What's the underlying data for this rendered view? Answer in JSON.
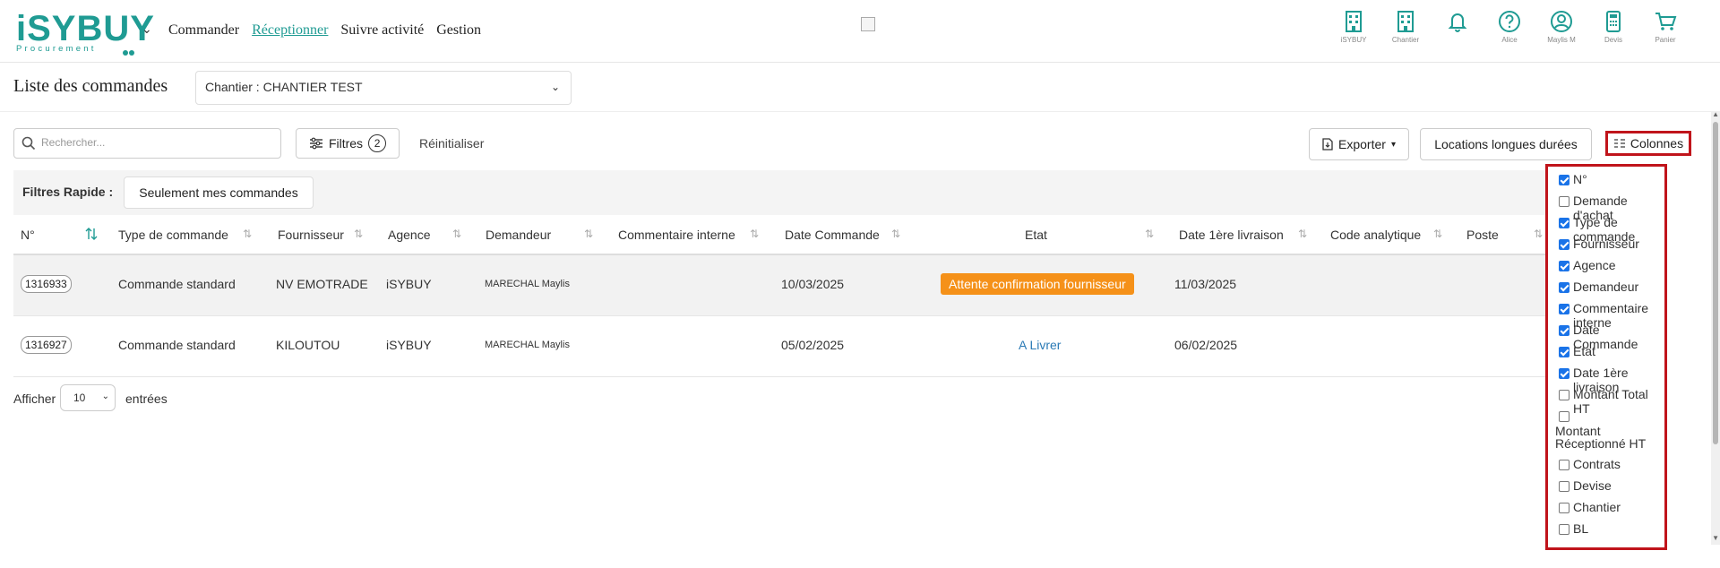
{
  "brand": {
    "name": "iSYBUY",
    "sub": "Procurement"
  },
  "nav": [
    "Commander",
    "Réceptionner",
    "Suivre activité",
    "Gestion"
  ],
  "top_icons": [
    {
      "icon": "building-icon",
      "label": "iSYBUY"
    },
    {
      "icon": "building-icon",
      "label": "Chantier"
    },
    {
      "icon": "bell-icon",
      "label": ""
    },
    {
      "icon": "help-icon",
      "label": "Alice"
    },
    {
      "icon": "user-icon",
      "label": "Maylis M"
    },
    {
      "icon": "calculator-icon",
      "label": "Devis"
    },
    {
      "icon": "cart-icon",
      "label": "Panier"
    }
  ],
  "page": {
    "title": "Liste des commandes",
    "chantier": "Chantier : CHANTIER TEST"
  },
  "toolbar": {
    "search_placeholder": "Rechercher...",
    "filtres": "Filtres",
    "filtres_count": "2",
    "reinitialiser": "Réinitialiser",
    "exporter": "Exporter",
    "locations": "Locations longues durées",
    "colonnes": "Colonnes"
  },
  "quick_filters": {
    "label": "Filtres Rapide :",
    "mine": "Seulement mes commandes"
  },
  "table": {
    "headers": [
      "N°",
      "Type de commande",
      "Fournisseur",
      "Agence",
      "Demandeur",
      "Commentaire interne",
      "Date Commande",
      "Etat",
      "Date 1ère livraison",
      "Code analytique",
      "Poste"
    ],
    "rows": [
      {
        "num": "1316933",
        "type": "Commande standard",
        "fournisseur": "NV EMOTRADE",
        "agence": "iSYBUY",
        "demandeur": "MARECHAL Maylis",
        "commentaire": "",
        "date": "10/03/2025",
        "etat": "Attente confirmation fournisseur",
        "livraison": "11/03/2025"
      },
      {
        "num": "1316927",
        "type": "Commande standard",
        "fournisseur": "KILOUTOU",
        "agence": "iSYBUY",
        "demandeur": "MARECHAL Maylis",
        "commentaire": "",
        "date": "05/02/2025",
        "etat": "A Livrer",
        "livraison": "06/02/2025"
      }
    ]
  },
  "pagination": {
    "afficher": "Afficher",
    "entries": "10",
    "entrees": "entrées"
  },
  "columns_menu": [
    {
      "label": "N°",
      "checked": true
    },
    {
      "label": "Demande d'achat",
      "checked": false
    },
    {
      "label": "Type de commande",
      "checked": true
    },
    {
      "label": "Fournisseur",
      "checked": true
    },
    {
      "label": "Agence",
      "checked": true
    },
    {
      "label": "Demandeur",
      "checked": true
    },
    {
      "label": "Commentaire interne",
      "checked": true
    },
    {
      "label": "Date Commande",
      "checked": true
    },
    {
      "label": "Etat",
      "checked": true
    },
    {
      "label": "Date 1ère livraison",
      "checked": true
    },
    {
      "label": "Montant Total HT",
      "checked": false
    },
    {
      "label": "Montant Réceptionné HT",
      "checked": false
    },
    {
      "label": "Contrats",
      "checked": false
    },
    {
      "label": "Devise",
      "checked": false
    },
    {
      "label": "Chantier",
      "checked": false
    },
    {
      "label": "BL",
      "checked": false
    }
  ],
  "colors": {
    "brand": "#1f9b93",
    "orange": "#f59119",
    "link": "#2a7ab5",
    "highlight": "#c0141b"
  }
}
